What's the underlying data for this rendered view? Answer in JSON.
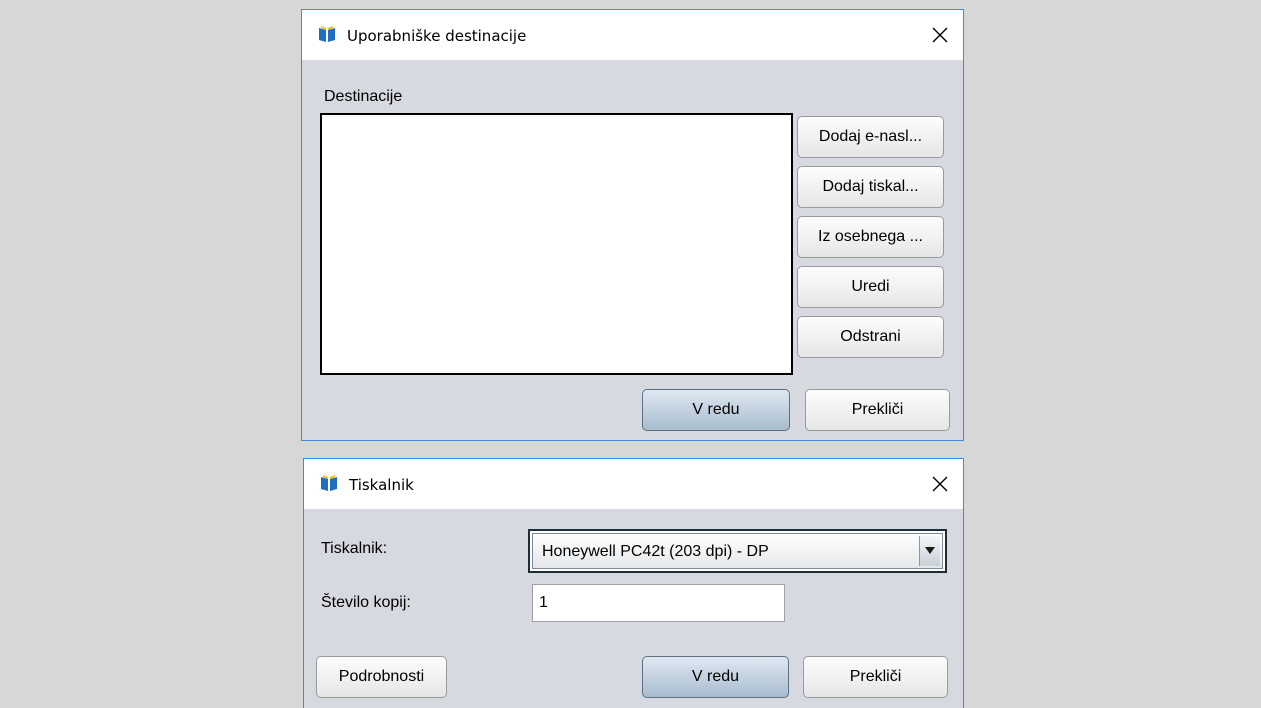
{
  "dialog_destinations": {
    "title": "Uporabniške destinacije",
    "list_label": "Destinacije",
    "buttons": {
      "add_email": "Dodaj e-nasl...",
      "add_printer": "Dodaj tiskal...",
      "from_personal": "Iz osebnega ...",
      "edit": "Uredi",
      "remove": "Odstrani",
      "ok": "V redu",
      "cancel": "Prekliči"
    }
  },
  "dialog_printer": {
    "title": "Tiskalnik",
    "printer_label": "Tiskalnik:",
    "printer_selected": "Honeywell PC42t (203 dpi) - DP",
    "copies_label": "Število kopij:",
    "copies_value": "1",
    "buttons": {
      "details": "Podrobnosti",
      "ok": "V redu",
      "cancel": "Prekliči"
    }
  },
  "icons": {
    "app": "app-book-icon",
    "close": "close-icon",
    "dropdown": "dropdown-arrow-icon"
  },
  "colors": {
    "window_border": "#3c8ce0",
    "dialog_bg": "#d6d9df",
    "default_button": "#a8bccf"
  }
}
